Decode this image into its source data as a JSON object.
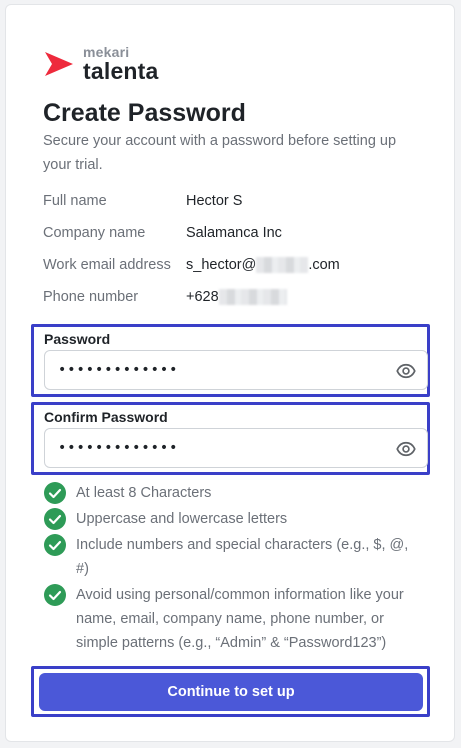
{
  "brand": {
    "top": "mekari",
    "name": "talenta"
  },
  "header": {
    "title": "Create Password",
    "subtitle": "Secure your account with a password before setting up your trial."
  },
  "info": {
    "full_name_label": "Full name",
    "full_name_value": "Hector S",
    "company_label": "Company name",
    "company_value": "Salamanca Inc",
    "email_label": "Work email address",
    "email_prefix": "s_hector@",
    "email_suffix": ".com",
    "phone_label": "Phone number",
    "phone_prefix": "+628"
  },
  "password": {
    "label": "Password",
    "value": "•••••••••••••",
    "icon": "eye-icon"
  },
  "confirm_password": {
    "label": "Confirm Password",
    "value": "•••••••••••••",
    "icon": "eye-icon"
  },
  "requirements": [
    "At least 8 Characters",
    "Uppercase and lowercase letters",
    "Include numbers and special characters (e.g., $, @, #)",
    "Avoid using personal/common information like your name, email, company name, phone number, or simple patterns (e.g., “Admin” & “Password123”)"
  ],
  "button": {
    "label": "Continue to set up"
  },
  "colors": {
    "accent": "#4b58d8",
    "highlight": "#3a3fc8",
    "check": "#2e9b57",
    "logo_red": "#ee2a3c"
  }
}
